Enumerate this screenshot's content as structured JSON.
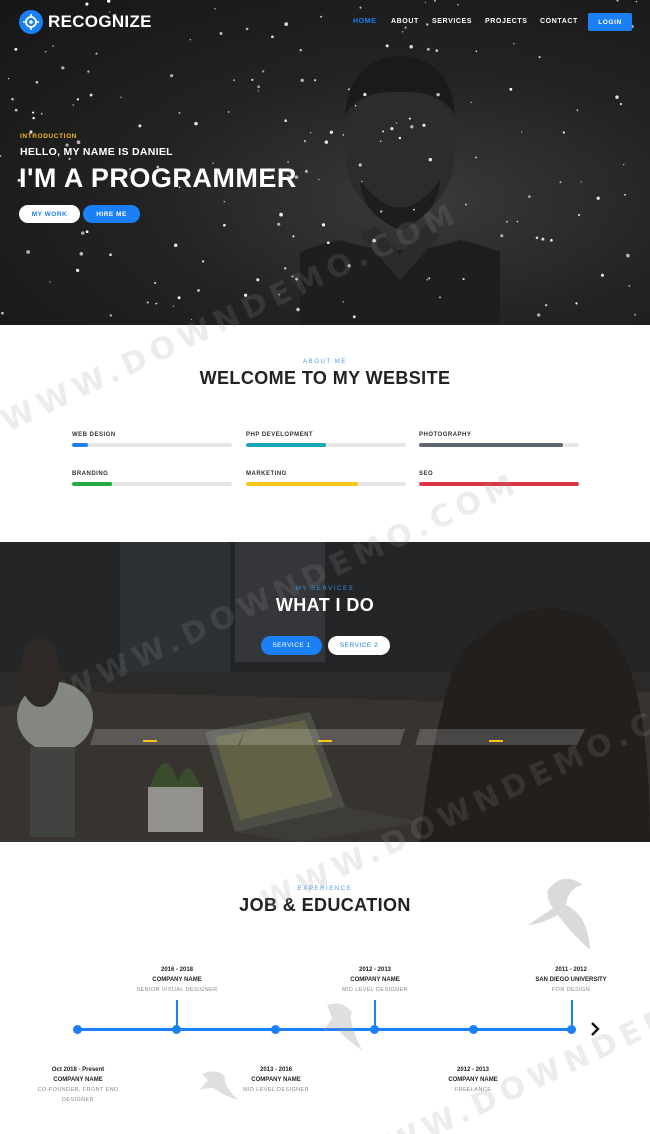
{
  "nav": {
    "brand": "RECOGNIZE",
    "items": [
      "HOME",
      "ABOUT",
      "SERVICES",
      "PROJECTS",
      "CONTACT"
    ],
    "active": "HOME",
    "login": "LOGIN"
  },
  "hero": {
    "intro": "INTRODUCTION",
    "hello": "HELLO, MY NAME IS DANIEL",
    "headline": "I'M A PROGRAMMER",
    "btn_work": "MY WORK",
    "btn_hire": "HIRE ME"
  },
  "about": {
    "eyebrow": "ABOUT ME",
    "title": "WELCOME TO MY WEBSITE",
    "skills": [
      {
        "name": "WEB DESIGN",
        "level": 0.1,
        "color": "#1b7ff5"
      },
      {
        "name": "PHP DEVELOPMENT",
        "level": 0.5,
        "color": "#16a6b6"
      },
      {
        "name": "PHOTOGRAPHY",
        "level": 0.9,
        "color": "#5d6771"
      },
      {
        "name": "BRANDING",
        "level": 0.25,
        "color": "#28a745"
      },
      {
        "name": "MARKETING",
        "level": 0.7,
        "color": "#f5c518"
      },
      {
        "name": "SEO",
        "level": 1.0,
        "color": "#dc3545"
      }
    ]
  },
  "services": {
    "eyebrow": "MY SERVICES",
    "title": "WHAT I DO",
    "tab1": "SERVICE 1",
    "tab2": "SERVICE 2"
  },
  "experience": {
    "eyebrow": "EXPERIENCE",
    "title": "JOB & EDUCATION",
    "entries": [
      {
        "date": "Oct 2018 - Present",
        "company": "COMPANY NAME",
        "role": "CO-FOUNDER, FRONT END DESIGNER"
      },
      {
        "date": "2016 - 2018",
        "company": "COMPANY NAME",
        "role": "SENIOR VISUAL DESIGNER"
      },
      {
        "date": "2013 - 2016",
        "company": "COMPANY NAME",
        "role": "MID LEVEL DESIGNER"
      },
      {
        "date": "2012 - 2013",
        "company": "COMPANY NAME",
        "role": "MID LEVEL DESIGNER"
      },
      {
        "date": "2012 - 2013",
        "company": "COMPANY NAME",
        "role": "FREELANCE"
      },
      {
        "date": "2011 - 2012",
        "company": "SAN DIEGO UNIVERSITY",
        "role": "FOR DESIGN"
      }
    ]
  },
  "watermark": "WWW.DOWNDEMO.COM",
  "colors": {
    "accent": "#1b7ff5",
    "intro_yellow": "#f4b728"
  }
}
